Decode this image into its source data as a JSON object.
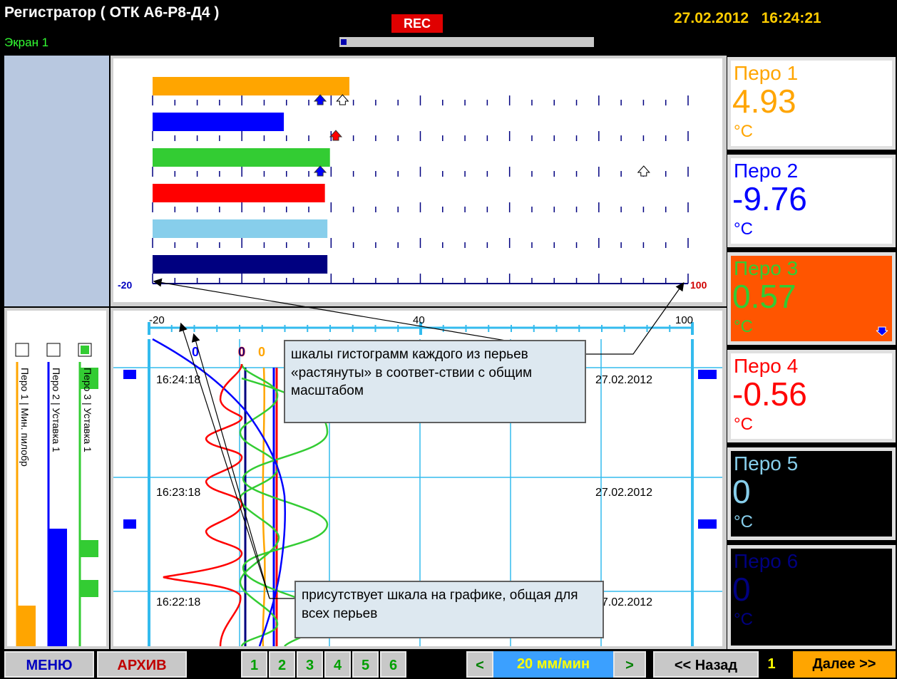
{
  "header": {
    "title": "Регистратор ( ОТК А6-Р8-Д4 )",
    "screen": "Экран 1",
    "rec": "REC",
    "date": "27.02.2012",
    "time": "16:24:21",
    "progress": 0.03
  },
  "histogram": {
    "scale_min": "-20",
    "scale_max": "100",
    "bars": [
      {
        "pen": "Перо 1",
        "value": 4.93,
        "color": "#ffa500",
        "markers": [
          {
            "v": 3.5,
            "type": "blue"
          },
          {
            "v": 8.5,
            "type": "hollow"
          }
        ]
      },
      {
        "pen": "Перо 2",
        "value": -9.76,
        "color": "#0000ff",
        "markers": [
          {
            "v": 7.0,
            "type": "red"
          }
        ]
      },
      {
        "pen": "Перо 3",
        "value": 0.57,
        "color": "#33cc33",
        "markers": [
          {
            "v": 3.5,
            "type": "blue"
          },
          {
            "v": 76.0,
            "type": "hollow"
          }
        ]
      },
      {
        "pen": "Перо 4",
        "value": -0.56,
        "color": "#ff0000",
        "markers": []
      },
      {
        "pen": "Перо 5",
        "value": 0,
        "color": "#87ceeb",
        "markers": []
      },
      {
        "pen": "Перо 6",
        "value": 0,
        "color": "#000080",
        "markers": []
      }
    ]
  },
  "trend": {
    "scale_labels": [
      "-20",
      "40",
      "100"
    ],
    "rows": [
      {
        "time": "16:24:18",
        "date": "27.02.2012"
      },
      {
        "time": "16:23:18",
        "date": "27.02.2012"
      },
      {
        "time": "16:22:18",
        "date": "27.02.2012"
      }
    ],
    "markers": [
      "0",
      "0",
      "0"
    ]
  },
  "legend": {
    "items": [
      "Перо 1 | Мин. пилобр",
      "Перо 2 | Уставка 1",
      "Перо 3 | Уставка 1"
    ]
  },
  "pens": [
    {
      "name": "Перо 1",
      "value": "4.93",
      "unit": "°C"
    },
    {
      "name": "Перо 2",
      "value": "-9.76",
      "unit": "°C"
    },
    {
      "name": "Перо 3",
      "value": "0.57",
      "unit": "°C"
    },
    {
      "name": "Перо 4",
      "value": "-0.56",
      "unit": "°C"
    },
    {
      "name": "Перо 5",
      "value": "0",
      "unit": "°C"
    },
    {
      "name": "Перо 6",
      "value": "0",
      "unit": "°C"
    }
  ],
  "callouts": {
    "top": "шкалы гистограмм каждого из перьев «растянуты» в соответ-ствии с общим масштабом",
    "bottom": "присутствует шкала на графике, общая для всех перьев"
  },
  "footer": {
    "menu": "МЕНЮ",
    "archive": "АРХИВ",
    "tabs": [
      "1",
      "2",
      "3",
      "4",
      "5",
      "6"
    ],
    "speed_prev": "<",
    "speed": "20 мм/мин",
    "speed_next": ">",
    "back": "<< Назад",
    "page": "1",
    "next": "Далее >>"
  },
  "colors": {
    "pen1": "#ffa500",
    "pen2": "#0000ff",
    "pen3": "#33cc33",
    "pen4": "#ff0000",
    "pen5": "#000000",
    "pen6": "#000000",
    "alarm_tile": "#ff5500",
    "grid": "#33bbee"
  }
}
